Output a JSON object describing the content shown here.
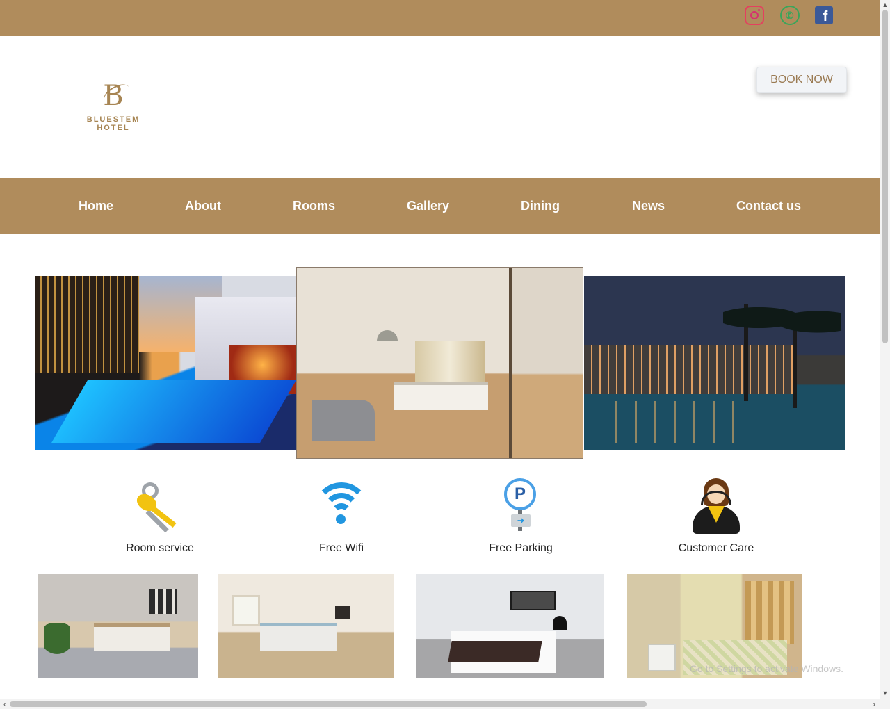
{
  "social": {
    "instagram_icon": "instagram-icon",
    "whatsapp_icon": "whatsapp-icon",
    "facebook_icon": "facebook-icon",
    "facebook_glyph": "f"
  },
  "header": {
    "logo_mark": "B",
    "logo_name": "BLUESTEM HOTEL",
    "book_now": "BOOK NOW"
  },
  "nav": {
    "items": [
      "Home",
      "About",
      "Rooms",
      "Gallery",
      "Dining",
      "News",
      "Contact us"
    ]
  },
  "amenities": {
    "room_service": "Room service",
    "free_wifi": "Free Wifi",
    "free_parking": "Free Parking",
    "parking_letter": "P",
    "customer_care": "Customer Care"
  },
  "watermark": {
    "text": "Go to Settings to activate Windows."
  },
  "colors": {
    "brand_gold": "#b08c5c",
    "wifi_blue": "#2196e0"
  }
}
